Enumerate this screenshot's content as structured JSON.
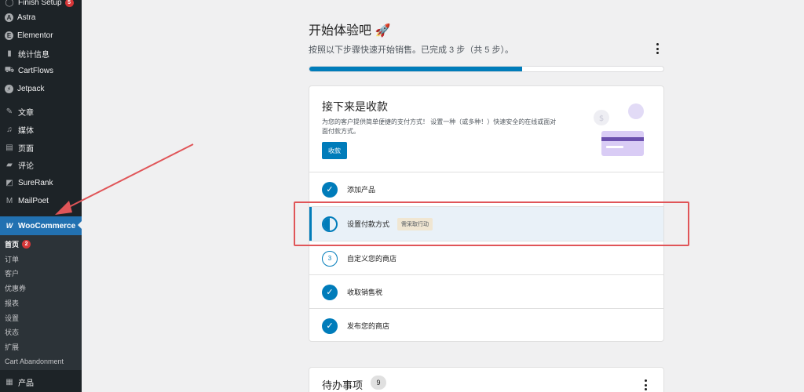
{
  "sidebar": {
    "items": [
      {
        "label": "Finish Setup",
        "icon": "circle-icon",
        "badge": "5"
      },
      {
        "label": "Astra",
        "icon": "astra-icon"
      },
      {
        "label": "Elementor",
        "icon": "elementor-icon"
      },
      {
        "label": "统计信息",
        "icon": "stats-icon"
      },
      {
        "label": "CartFlows",
        "icon": "cartflows-icon"
      },
      {
        "label": "Jetpack",
        "icon": "jetpack-icon"
      },
      {
        "label": "文章",
        "icon": "pin-icon"
      },
      {
        "label": "媒体",
        "icon": "media-icon"
      },
      {
        "label": "页面",
        "icon": "page-icon"
      },
      {
        "label": "评论",
        "icon": "comment-icon"
      },
      {
        "label": "SureRank",
        "icon": "surerank-icon"
      },
      {
        "label": "MailPoet",
        "icon": "mailpoet-icon"
      }
    ],
    "woocommerce": {
      "label": "WooCommerce",
      "icon": "woo-icon"
    },
    "submenu": [
      {
        "label": "首页",
        "badge": "2"
      },
      {
        "label": "订单"
      },
      {
        "label": "客户"
      },
      {
        "label": "优惠券"
      },
      {
        "label": "报表"
      },
      {
        "label": "设置"
      },
      {
        "label": "状态"
      },
      {
        "label": "扩展"
      },
      {
        "label": "Cart Abandonment"
      }
    ],
    "products": {
      "label": "产品",
      "icon": "products-icon"
    }
  },
  "setup": {
    "title": "开始体验吧 🚀",
    "subtitle": "按照以下步骤快速开始销售。已完成 3 步（共 5 步）。",
    "progress": 0.6
  },
  "card": {
    "title": "接下来是收款",
    "description": "为您的客户提供简单便捷的支付方式！ 设置一种（或多种！）快速安全的在线或面对面付款方式。",
    "button": "收款",
    "tasks": [
      {
        "label": "添加产品",
        "state": "done"
      },
      {
        "label": "设置付款方式",
        "state": "active",
        "tag": "需采取行动"
      },
      {
        "label": "自定义您的商店",
        "state": "todo",
        "number": "3"
      },
      {
        "label": "收取销售税",
        "state": "done"
      },
      {
        "label": "发布您的商店",
        "state": "done"
      }
    ]
  },
  "todo": {
    "title": "待办事项",
    "count": "9"
  },
  "colors": {
    "accent": "#007cba",
    "sidebar": "#1d2327",
    "annotation": "#e05558"
  }
}
